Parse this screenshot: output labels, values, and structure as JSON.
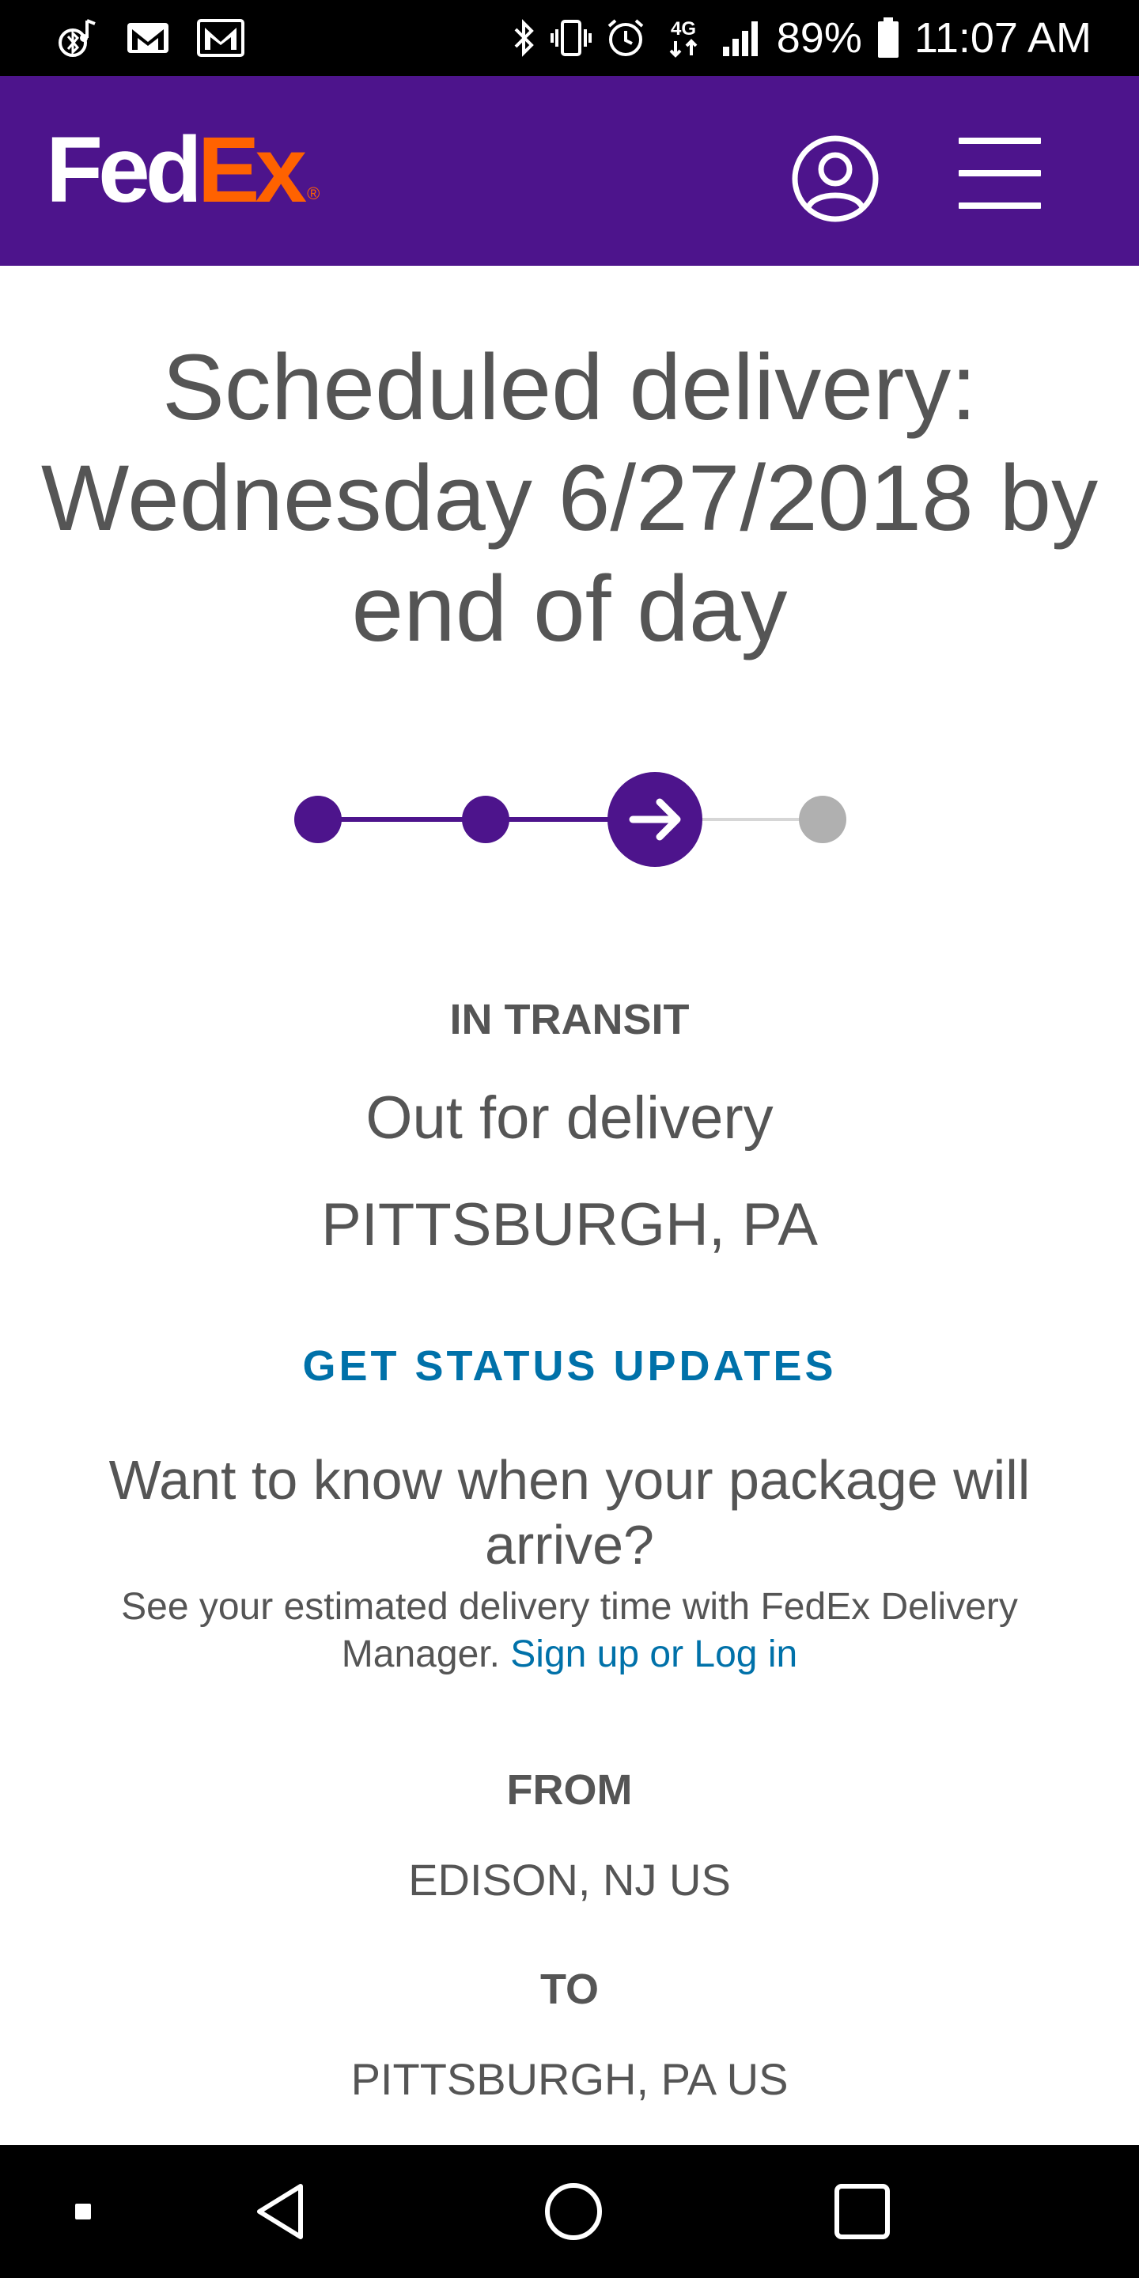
{
  "status_bar": {
    "battery": "89%",
    "time": "11:07 AM",
    "network": "4G",
    "icons": [
      "bluetooth-music-icon",
      "gmail-icon",
      "gmail-outline-icon",
      "bluetooth-icon",
      "vibrate-icon",
      "alarm-icon",
      "lte-icon",
      "signal-icon",
      "battery-icon"
    ]
  },
  "header": {
    "logo_fed": "Fed",
    "logo_ex": "Ex",
    "logo_reg": "®",
    "account_icon": "user-circle-icon",
    "menu_icon": "hamburger-menu-icon",
    "brand_color": "#4d148c",
    "accent_color": "#ff6200"
  },
  "shipment": {
    "scheduled_line1": "Scheduled delivery:",
    "scheduled_line2": "Wednesday 6/27/2018 by",
    "scheduled_line3": "end of day",
    "progress": {
      "total_steps": 4,
      "current_step": 3
    },
    "status_label": "IN TRANSIT",
    "status_description": "Out for delivery",
    "status_location": "PITTSBURGH, PA"
  },
  "updates": {
    "link_label": "GET STATUS UPDATES"
  },
  "promo": {
    "title_line1": "Want to know when your package will",
    "title_line2": "arrive?",
    "body_line1": "See your estimated delivery time with FedEx Delivery",
    "body_line2": "Manager. ",
    "link": "Sign up or Log in"
  },
  "route": {
    "from_label": "FROM",
    "from_value": "EDISON, NJ US",
    "to_label": "TO",
    "to_value": "PITTSBURGH, PA US"
  },
  "nav_bar": {
    "icons": [
      "recent-dot-icon",
      "back-icon",
      "home-icon",
      "overview-icon"
    ]
  },
  "colors": {
    "link": "#0071a9",
    "progress_active": "#4d148c",
    "progress_inactive": "#b0b0b0"
  }
}
